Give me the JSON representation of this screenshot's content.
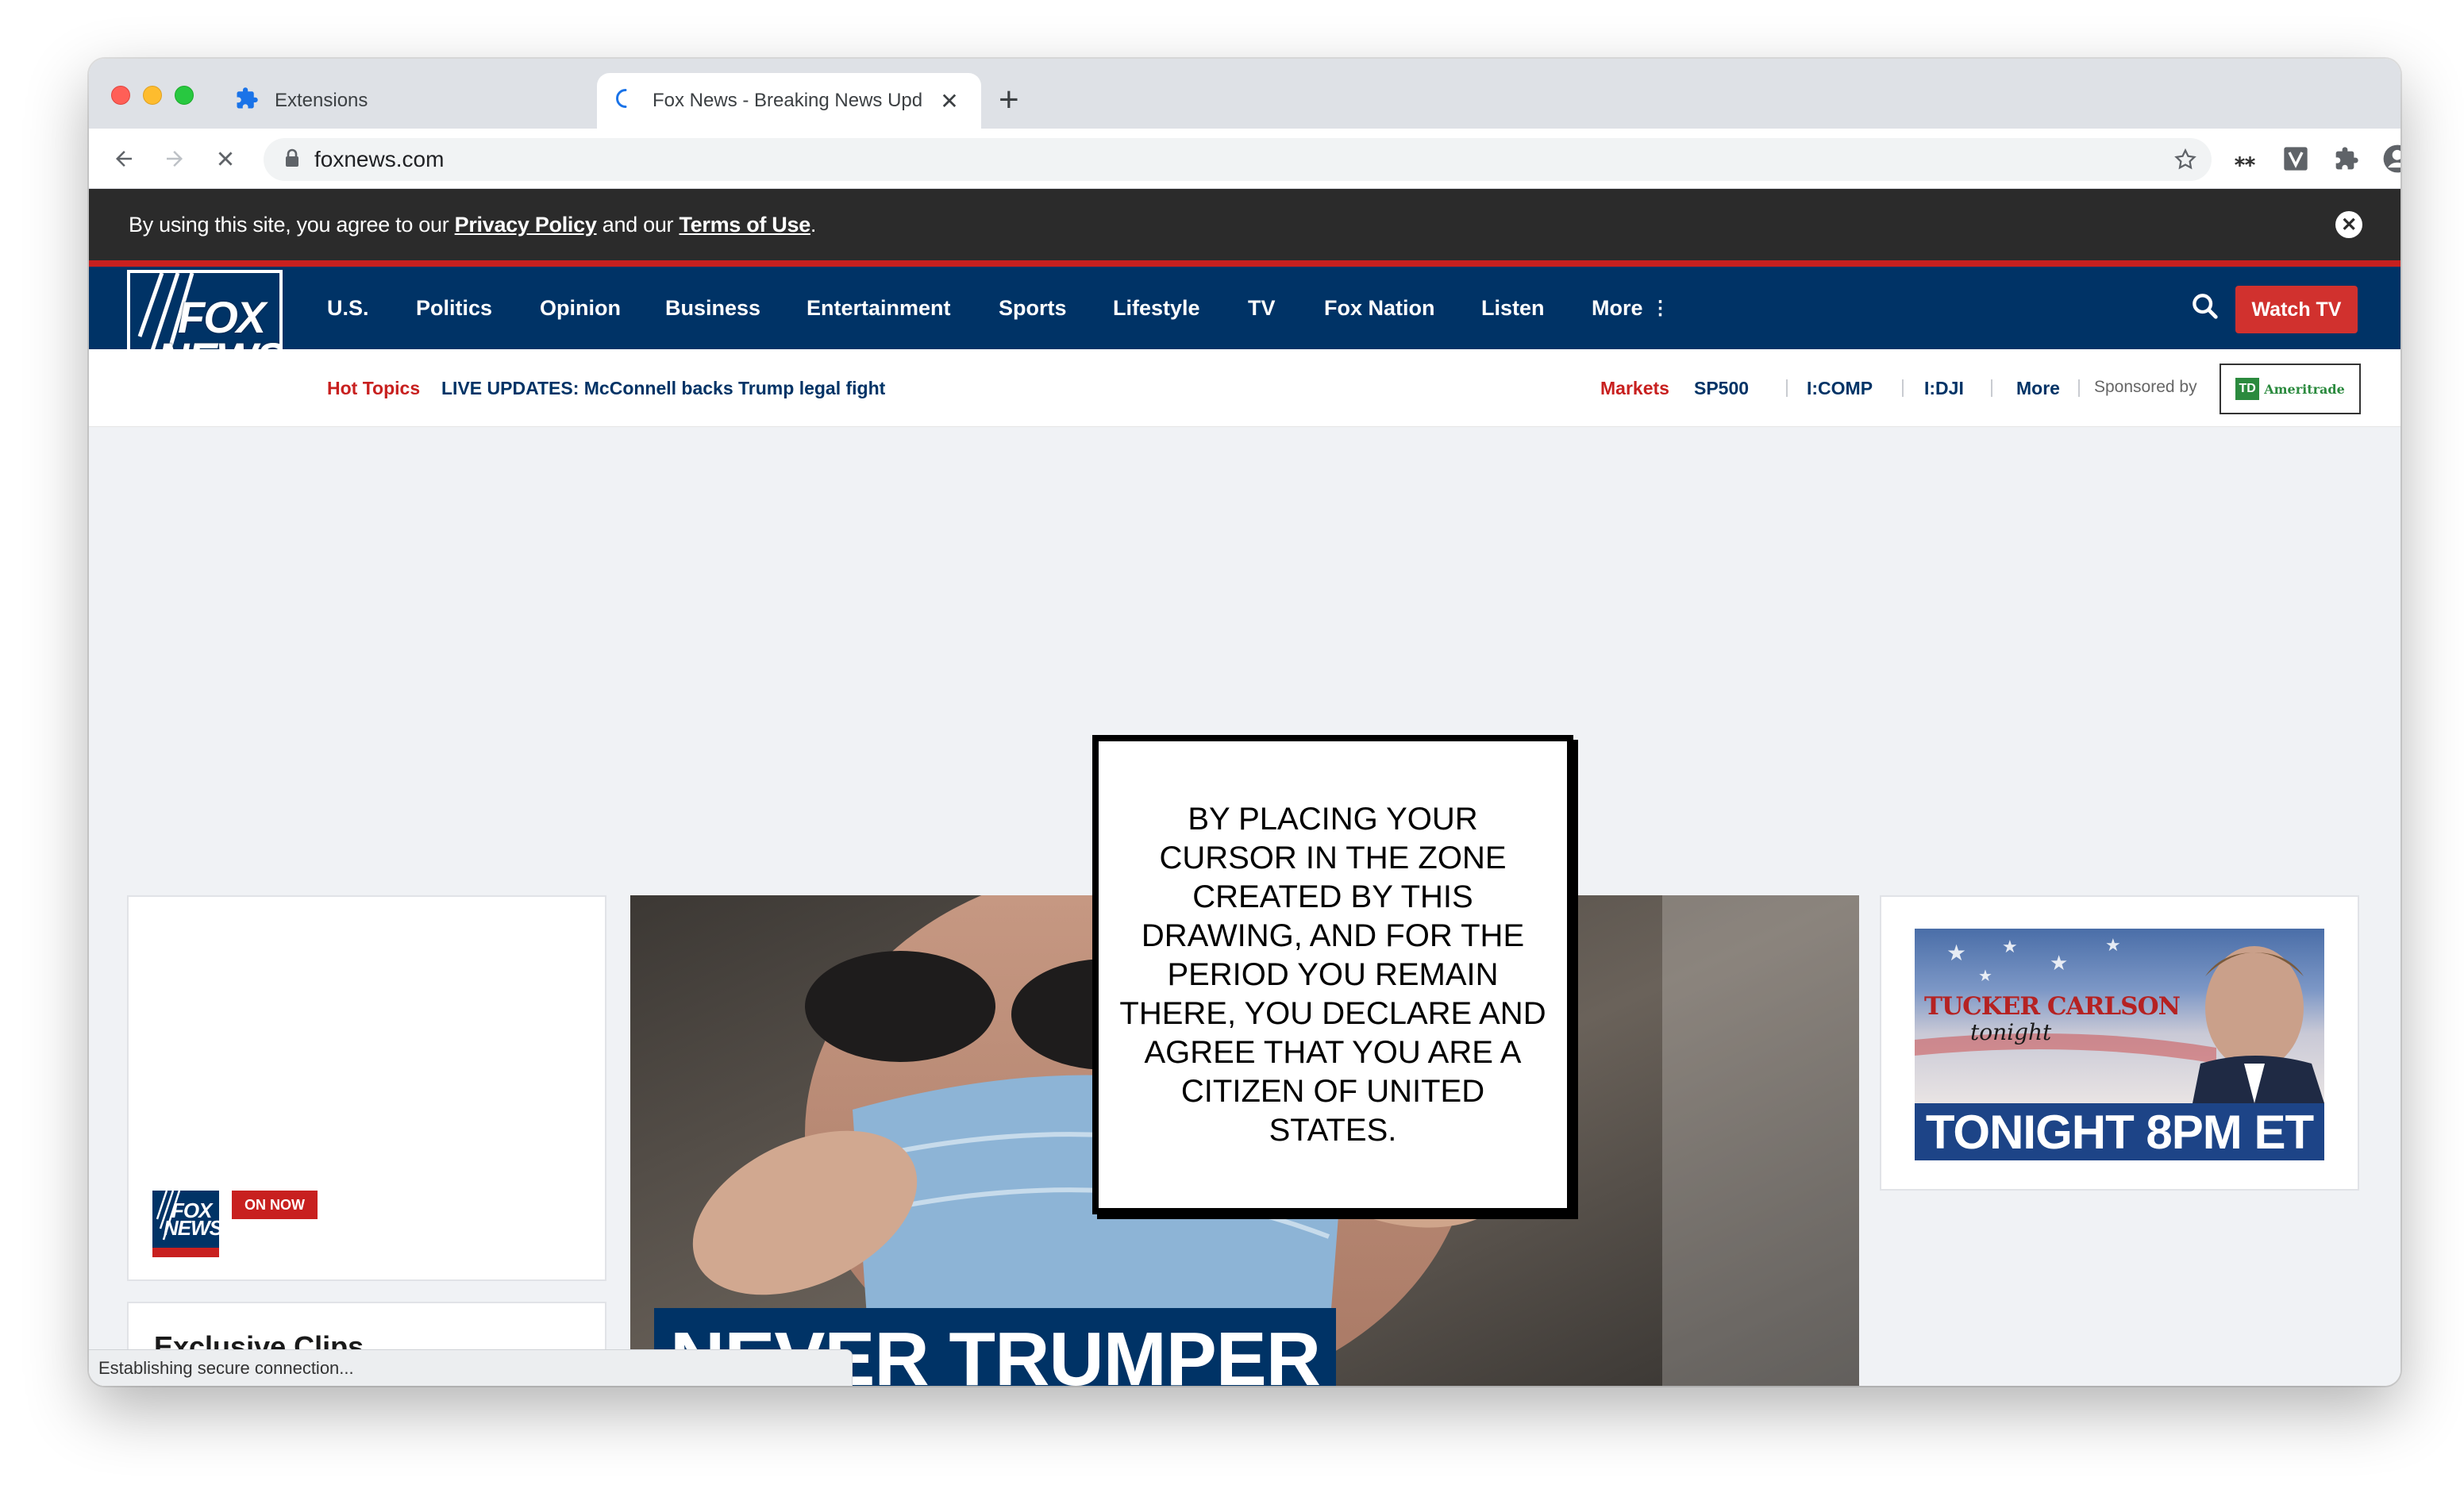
{
  "browser": {
    "tabs": [
      {
        "title": "Extensions",
        "icon": "puzzle-icon"
      },
      {
        "title": "Fox News - Breaking News Upd",
        "icon": "loading-spinner-icon"
      }
    ],
    "url": "foxnews.com",
    "status_text": "Establishing secure connection..."
  },
  "cookie_bar": {
    "prefix": "By using this site, you agree to our ",
    "privacy_link": "Privacy Policy",
    "middle": " and our ",
    "terms_link": "Terms of Use",
    "suffix": "."
  },
  "logo": {
    "line1": "FOX",
    "line2": "NEWS"
  },
  "nav": {
    "items": [
      "U.S.",
      "Politics",
      "Opinion",
      "Business",
      "Entertainment",
      "Sports",
      "Lifestyle",
      "TV",
      "Fox Nation",
      "Listen",
      "More"
    ],
    "watch_tv": "Watch TV"
  },
  "sub_nav": {
    "hot_topics_label": "Hot Topics",
    "hot_topic": "LIVE UPDATES: McConnell backs Trump legal fight",
    "markets_label": "Markets",
    "tickers": [
      "SP500",
      "I:COMP",
      "I:DJI"
    ],
    "more": "More",
    "sponsored_by": "Sponsored by",
    "sponsor": "Ameritrade",
    "sponsor_mark": "TD"
  },
  "left_card": {
    "mini_logo": {
      "line1": "FOX",
      "line2": "NEWS"
    },
    "on_now": "ON NOW"
  },
  "left_card2": {
    "title": "Exclusive Clips"
  },
  "hero": {
    "headline": "NEVER TRUMPER"
  },
  "right_card": {
    "show_name": "TUCKER CARLSON",
    "show_sub": "tonight",
    "time": "TONIGHT 8PM ET"
  },
  "overlay": {
    "text": "BY PLACING YOUR CURSOR IN THE ZONE CREATED BY THIS DRAWING, AND FOR THE PERIOD YOU REMAIN THERE, YOU DECLARE AND AGREE THAT YOU ARE A CITIZEN OF UNITED STATES."
  },
  "colors": {
    "fox_navy": "#003366",
    "fox_red": "#c8201f",
    "cookie_bg": "#2b2b2b"
  }
}
